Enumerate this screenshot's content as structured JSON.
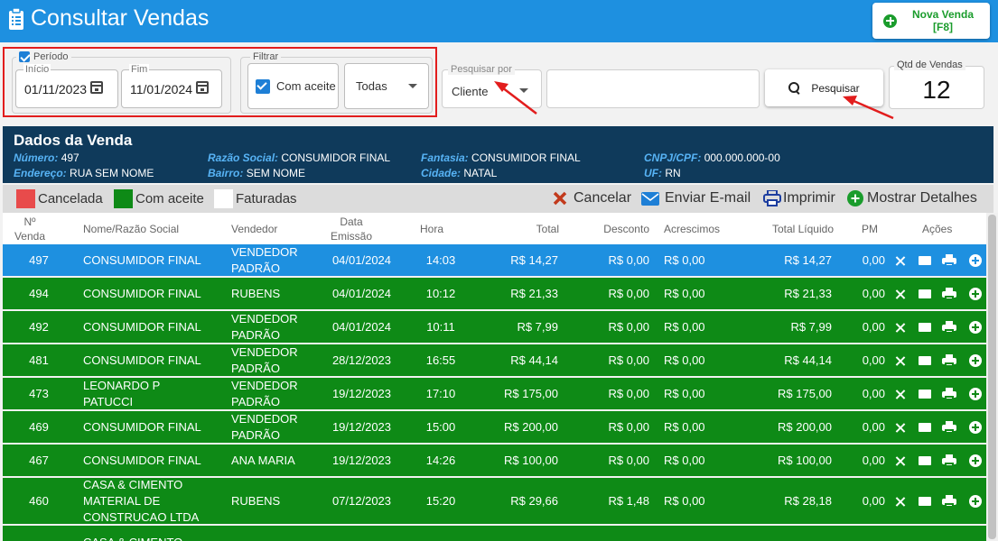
{
  "header": {
    "title": "Consultar Vendas",
    "new_sale_label": "Nova Venda [F8]"
  },
  "filters": {
    "period_label": "Período",
    "period_checked": true,
    "start_label": "Início",
    "start_value": "01/11/2023",
    "end_label": "Fim",
    "end_value": "11/01/2024",
    "filter_label": "Filtrar",
    "accepted_label": "Com aceite",
    "accepted_checked": true,
    "status_value": "Todas",
    "search_by_label": "Pesquisar por",
    "search_by_value": "Cliente",
    "search_text": "",
    "search_button": "Pesquisar",
    "count_label": "Qtd de Vendas",
    "count_value": "12"
  },
  "sale_data": {
    "title": "Dados da Venda",
    "numero_k": "Número:",
    "numero_v": "497",
    "endereco_k": "Endereço:",
    "endereco_v": "RUA SEM NOME",
    "razao_k": "Razão Social:",
    "razao_v": "CONSUMIDOR FINAL",
    "bairro_k": "Bairro:",
    "bairro_v": "SEM NOME",
    "fantasia_k": "Fantasia:",
    "fantasia_v": "CONSUMIDOR FINAL",
    "cidade_k": "Cidade:",
    "cidade_v": "NATAL",
    "cnpj_k": "CNPJ/CPF:",
    "cnpj_v": "000.000.000-00",
    "uf_k": "UF:",
    "uf_v": "RN"
  },
  "legend": {
    "cancelada": "Cancelada",
    "com_aceite": "Com aceite",
    "faturadas": "Faturadas",
    "cancel": "Cancelar",
    "email": "Enviar E-mail",
    "print": "Imprimir",
    "details": "Mostrar Detalhes"
  },
  "colors": {
    "header": "#1e90e0",
    "selected_row": "#1e90e0",
    "accepted_row": "#0e8a16",
    "cancelled": "#e84b4b",
    "panel": "#0f3a5b"
  },
  "table": {
    "columns": {
      "num": "Nº Venda",
      "nome": "Nome/Razão Social",
      "vendedor": "Vendedor",
      "data": "Data Emissão",
      "hora": "Hora",
      "total": "Total",
      "desconto": "Desconto",
      "acrescimos": "Acrescimos",
      "liquido": "Total Líquido",
      "pm": "PM",
      "acoes": "Ações"
    },
    "rows": [
      {
        "num": "497",
        "nome": "CONSUMIDOR FINAL",
        "vendedor": "VENDEDOR PADRÃO",
        "data": "04/01/2024",
        "hora": "14:03",
        "total": "R$ 14,27",
        "desconto": "R$ 0,00",
        "acrescimos": "R$ 0,00",
        "liquido": "R$ 14,27",
        "pm": "0,00",
        "selected": true
      },
      {
        "num": "494",
        "nome": "CONSUMIDOR FINAL",
        "vendedor": "RUBENS",
        "data": "04/01/2024",
        "hora": "10:12",
        "total": "R$ 21,33",
        "desconto": "R$ 0,00",
        "acrescimos": "R$ 0,00",
        "liquido": "R$ 21,33",
        "pm": "0,00"
      },
      {
        "num": "492",
        "nome": "CONSUMIDOR FINAL",
        "vendedor": "VENDEDOR PADRÃO",
        "data": "04/01/2024",
        "hora": "10:11",
        "total": "R$ 7,99",
        "desconto": "R$ 0,00",
        "acrescimos": "R$ 0,00",
        "liquido": "R$ 7,99",
        "pm": "0,00"
      },
      {
        "num": "481",
        "nome": "CONSUMIDOR FINAL",
        "vendedor": "VENDEDOR PADRÃO",
        "data": "28/12/2023",
        "hora": "16:55",
        "total": "R$ 44,14",
        "desconto": "R$ 0,00",
        "acrescimos": "R$ 0,00",
        "liquido": "R$ 44,14",
        "pm": "0,00"
      },
      {
        "num": "473",
        "nome": "LEONARDO P PATUCCI",
        "vendedor": "VENDEDOR PADRÃO",
        "data": "19/12/2023",
        "hora": "17:10",
        "total": "R$ 175,00",
        "desconto": "R$ 0,00",
        "acrescimos": "R$ 0,00",
        "liquido": "R$ 175,00",
        "pm": "0,00"
      },
      {
        "num": "469",
        "nome": "CONSUMIDOR FINAL",
        "vendedor": "VENDEDOR PADRÃO",
        "data": "19/12/2023",
        "hora": "15:00",
        "total": "R$ 200,00",
        "desconto": "R$ 0,00",
        "acrescimos": "R$ 0,00",
        "liquido": "R$ 200,00",
        "pm": "0,00"
      },
      {
        "num": "467",
        "nome": "CONSUMIDOR FINAL",
        "vendedor": "ANA MARIA",
        "data": "19/12/2023",
        "hora": "14:26",
        "total": "R$ 100,00",
        "desconto": "R$ 0,00",
        "acrescimos": "R$ 0,00",
        "liquido": "R$ 100,00",
        "pm": "0,00"
      },
      {
        "num": "460",
        "nome": "CASA & CIMENTO MATERIAL DE CONSTRUCAO LTDA",
        "vendedor": "RUBENS",
        "data": "07/12/2023",
        "hora": "15:20",
        "total": "R$ 29,66",
        "desconto": "R$ 1,48",
        "acrescimos": "R$ 0,00",
        "liquido": "R$ 28,18",
        "pm": "0,00"
      },
      {
        "num": "",
        "nome": "CASA & CIMENTO",
        "vendedor": "",
        "data": "",
        "hora": "",
        "total": "",
        "desconto": "",
        "acrescimos": "",
        "liquido": "",
        "pm": ""
      }
    ]
  }
}
